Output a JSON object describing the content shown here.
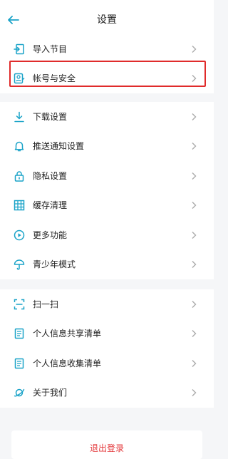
{
  "header": {
    "title": "设置"
  },
  "accent_color": "#1aa3c8",
  "groups": [
    {
      "items": [
        {
          "label": "导入节目",
          "icon": "import-icon"
        },
        {
          "label": "帐号与安全",
          "icon": "account-security-icon"
        }
      ]
    },
    {
      "items": [
        {
          "label": "下载设置",
          "icon": "download-icon"
        },
        {
          "label": "推送通知设置",
          "icon": "bell-icon"
        },
        {
          "label": "隐私设置",
          "icon": "lock-icon"
        },
        {
          "label": "缓存清理",
          "icon": "grid-icon"
        },
        {
          "label": "更多功能",
          "icon": "play-circle-icon"
        },
        {
          "label": "青少年模式",
          "icon": "umbrella-icon"
        }
      ]
    },
    {
      "items": [
        {
          "label": "扫一扫",
          "icon": "scan-icon"
        },
        {
          "label": "个人信息共享清单",
          "icon": "document-icon"
        },
        {
          "label": "个人信息收集清单",
          "icon": "document-icon"
        },
        {
          "label": "关于我们",
          "icon": "planet-icon"
        }
      ]
    }
  ],
  "logout_label": "退出登录"
}
